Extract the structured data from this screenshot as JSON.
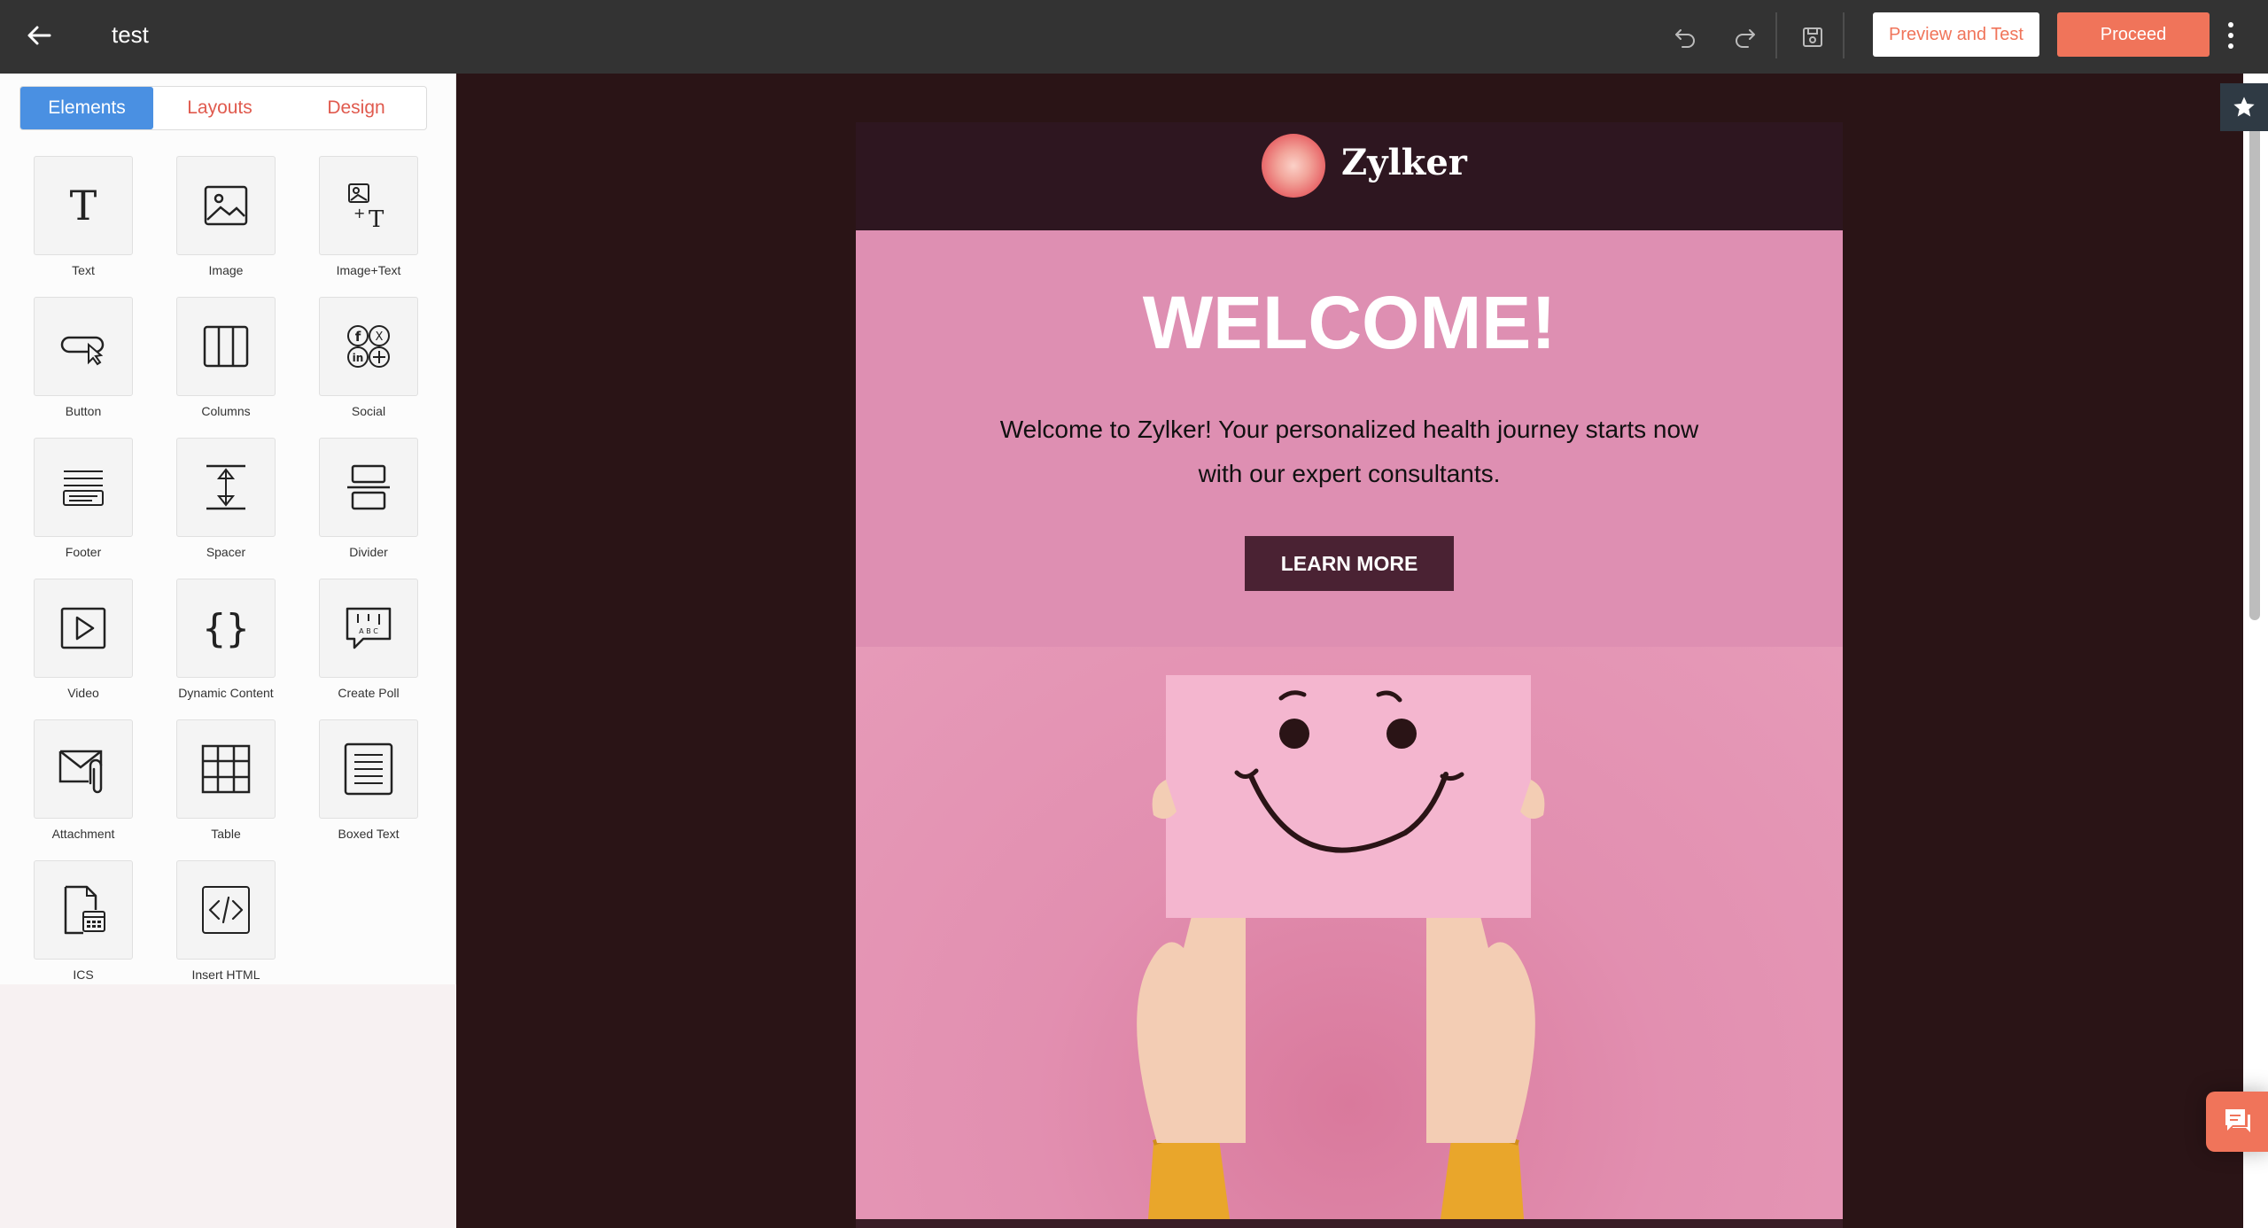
{
  "topbar": {
    "title": "test",
    "preview_label": "Preview and Test",
    "proceed_label": "Proceed",
    "icons": [
      "back-arrow-icon",
      "undo-icon",
      "redo-icon",
      "save-icon",
      "kebab-menu-icon"
    ]
  },
  "panel": {
    "tabs": [
      {
        "label": "Elements",
        "active": true
      },
      {
        "label": "Layouts",
        "active": false
      },
      {
        "label": "Design",
        "active": false
      }
    ],
    "elements": [
      {
        "label": "Text",
        "icon": "text-icon"
      },
      {
        "label": "Image",
        "icon": "image-icon"
      },
      {
        "label": "Image+Text",
        "icon": "image-text-icon"
      },
      {
        "label": "Button",
        "icon": "button-icon"
      },
      {
        "label": "Columns",
        "icon": "columns-icon"
      },
      {
        "label": "Social",
        "icon": "social-icon"
      },
      {
        "label": "Footer",
        "icon": "footer-icon"
      },
      {
        "label": "Spacer",
        "icon": "spacer-icon"
      },
      {
        "label": "Divider",
        "icon": "divider-icon"
      },
      {
        "label": "Video",
        "icon": "video-icon"
      },
      {
        "label": "Dynamic Content",
        "icon": "dynamic-content-icon"
      },
      {
        "label": "Create Poll",
        "icon": "poll-icon"
      },
      {
        "label": "Attachment",
        "icon": "attachment-icon"
      },
      {
        "label": "Table",
        "icon": "table-icon"
      },
      {
        "label": "Boxed Text",
        "icon": "boxed-text-icon"
      },
      {
        "label": "ICS",
        "icon": "ics-icon"
      },
      {
        "label": "Insert HTML",
        "icon": "html-icon"
      }
    ]
  },
  "email": {
    "brand": "Zylker",
    "heading": "WELCOME!",
    "intro": "Welcome to Zylker! Your personalized health journey starts now with our expert consultants.",
    "cta_label": "LEARN MORE"
  },
  "colors": {
    "accent": "#f0745a",
    "active_tab": "#4a90e2",
    "canvas_bg": "#2a1416",
    "email_bg": "#de8fb2",
    "cta_bg": "#4a2233"
  }
}
